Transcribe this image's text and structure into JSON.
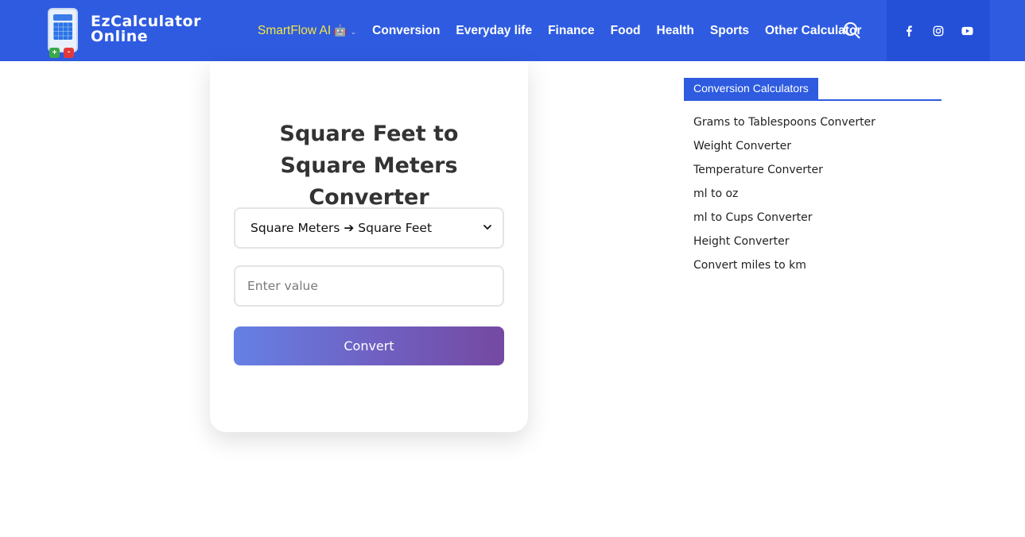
{
  "logo": {
    "line1": "EzCalculator",
    "line2": "Online",
    "plus": "+",
    "minus": "-"
  },
  "nav": {
    "items": [
      {
        "label": "SmartFlow AI",
        "icon": "🤖",
        "caret": "⌄"
      },
      {
        "label": "Conversion"
      },
      {
        "label": "Everyday life"
      },
      {
        "label": "Finance"
      },
      {
        "label": "Food"
      },
      {
        "label": "Health"
      },
      {
        "label": "Sports"
      },
      {
        "label": "Other Calculator"
      }
    ]
  },
  "social": {
    "icons": [
      "facebook-icon",
      "instagram-icon",
      "youtube-icon"
    ]
  },
  "converter": {
    "title": "Square Feet to Square Meters Converter",
    "selected_option": "Square Meters ➔ Square Feet",
    "input_placeholder": "Enter value",
    "input_value": "",
    "button_label": "Convert"
  },
  "sidebar": {
    "title": "Conversion Calculators",
    "items": [
      "Grams to Tablespoons Converter",
      "Weight Converter",
      "Temperature Converter",
      "ml to oz",
      "ml to Cups Converter",
      "Height Converter",
      "Convert miles to km"
    ]
  },
  "colors": {
    "header_bg": "#2e5be0",
    "social_bg": "#2450d8",
    "highlight_nav": "#f5e642",
    "button_gradient_start": "#6580e4",
    "button_gradient_end": "#7549a2"
  }
}
